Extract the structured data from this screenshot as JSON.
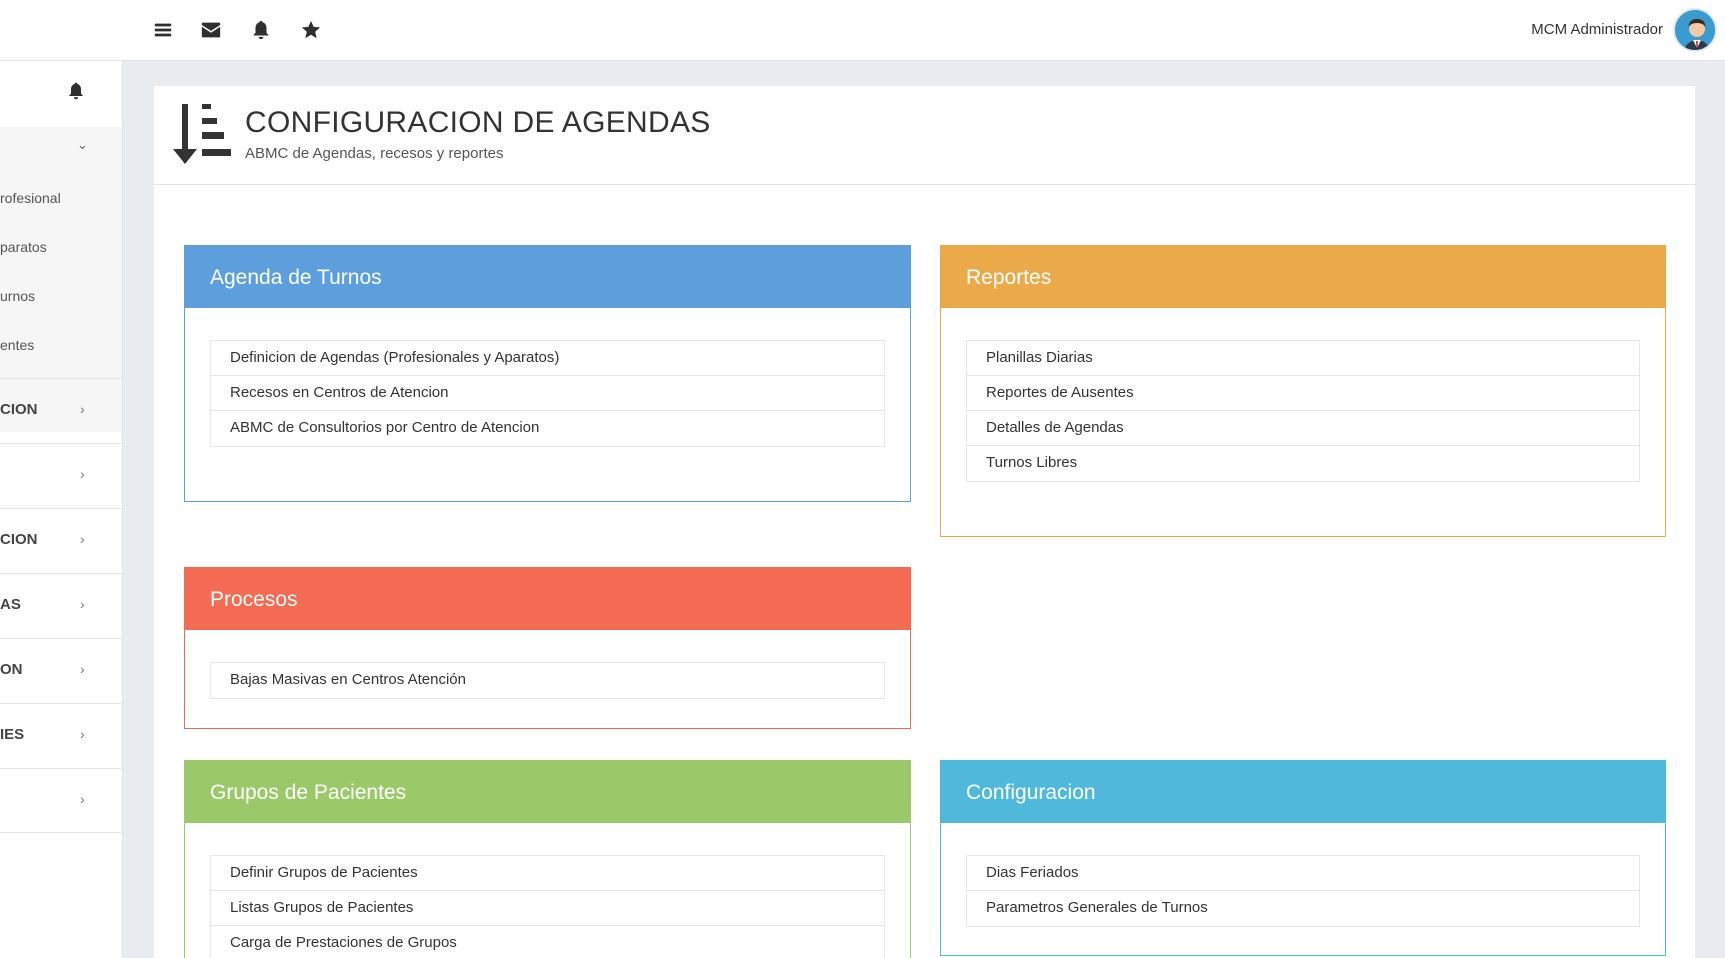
{
  "topbar": {
    "icons": [
      "menu-icon",
      "envelope-icon",
      "bell-icon",
      "star-icon"
    ],
    "user_name": "MCM Administrador"
  },
  "sidebar": {
    "submenu_items": [
      {
        "label": "rofesional"
      },
      {
        "label": "paratos"
      },
      {
        "label": "urnos"
      },
      {
        "label": "entes"
      }
    ],
    "items": [
      {
        "label": "CION"
      },
      {
        "label": ""
      },
      {
        "label": "CION"
      },
      {
        "label": "AS"
      },
      {
        "label": "ON"
      },
      {
        "label": "IES"
      },
      {
        "label": ""
      }
    ]
  },
  "page": {
    "title": "CONFIGURACION DE AGENDAS",
    "subtitle": "ABMC de Agendas, recesos y reportes"
  },
  "cards": {
    "agenda": {
      "title": "Agenda de Turnos",
      "items": [
        "Definicion de Agendas (Profesionales y Aparatos)",
        "Recesos en Centros de Atencion",
        "ABMC de Consultorios por Centro de Atencion"
      ]
    },
    "reportes": {
      "title": "Reportes",
      "items": [
        "Planillas Diarias",
        "Reportes de Ausentes",
        "Detalles de Agendas",
        "Turnos Libres"
      ]
    },
    "procesos": {
      "title": "Procesos",
      "items": [
        "Bajas Masivas en Centros Atención"
      ]
    },
    "grupos": {
      "title": "Grupos de Pacientes",
      "items": [
        "Definir Grupos de Pacientes",
        "Listas Grupos de Pacientes",
        "Carga de Prestaciones de Grupos"
      ]
    },
    "config": {
      "title": "Configuracion",
      "items": [
        "Dias Feriados",
        "Parametros Generales de Turnos"
      ]
    }
  },
  "colors": {
    "agenda": "#5c9fdc",
    "reportes": "#ebaa4a",
    "procesos": "#f36b52",
    "grupos": "#9bc96a",
    "config": "#4fb8db"
  }
}
